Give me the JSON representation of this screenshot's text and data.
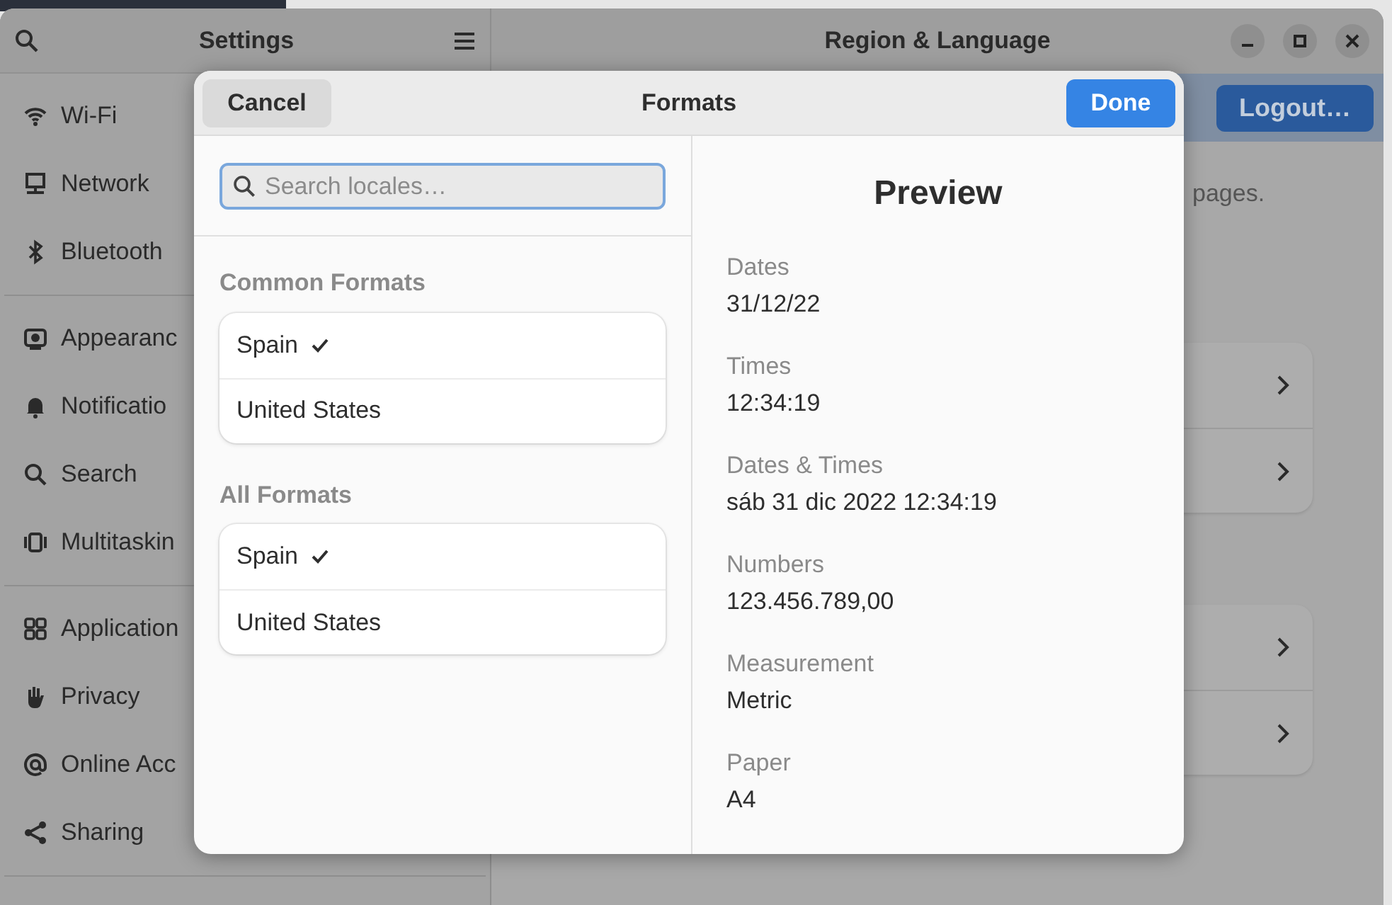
{
  "settings_window": {
    "sidebar": {
      "title": "Settings",
      "groups": [
        [
          "Wi-Fi",
          "Network",
          "Bluetooth"
        ],
        [
          "Appearanc",
          "Notificatio",
          "Search",
          "Multitaskin"
        ],
        [
          "Application",
          "Privacy",
          "Online Acc",
          "Sharing"
        ]
      ]
    },
    "content": {
      "title": "Region & Language",
      "logout_button": "Logout…",
      "description_fragment": "pages.",
      "cards": [
        {
          "rows": [
            {
              "kind": "link"
            },
            {
              "kind": "link"
            }
          ]
        },
        {
          "rows": [
            {
              "kind": "link"
            },
            {
              "kind": "link"
            }
          ]
        }
      ]
    }
  },
  "formats_dialog": {
    "title": "Formats",
    "cancel_button": "Cancel",
    "done_button": "Done",
    "search": {
      "placeholder": "Search locales…"
    },
    "sections": [
      {
        "heading": "Common Formats",
        "items": [
          {
            "label": "Spain",
            "selected": true
          },
          {
            "label": "United States",
            "selected": false
          }
        ]
      },
      {
        "heading": "All Formats",
        "items": [
          {
            "label": "Spain",
            "selected": true
          },
          {
            "label": "United States",
            "selected": false
          }
        ]
      }
    ],
    "preview": {
      "title": "Preview",
      "rows": [
        {
          "label": "Dates",
          "value": "31/12/22"
        },
        {
          "label": "Times",
          "value": "12:34:19"
        },
        {
          "label": "Dates & Times",
          "value": "sáb 31 dic 2022 12:34:19"
        },
        {
          "label": "Numbers",
          "value": "123.456.789,00"
        },
        {
          "label": "Measurement",
          "value": "Metric"
        },
        {
          "label": "Paper",
          "value": "A4"
        }
      ]
    }
  }
}
